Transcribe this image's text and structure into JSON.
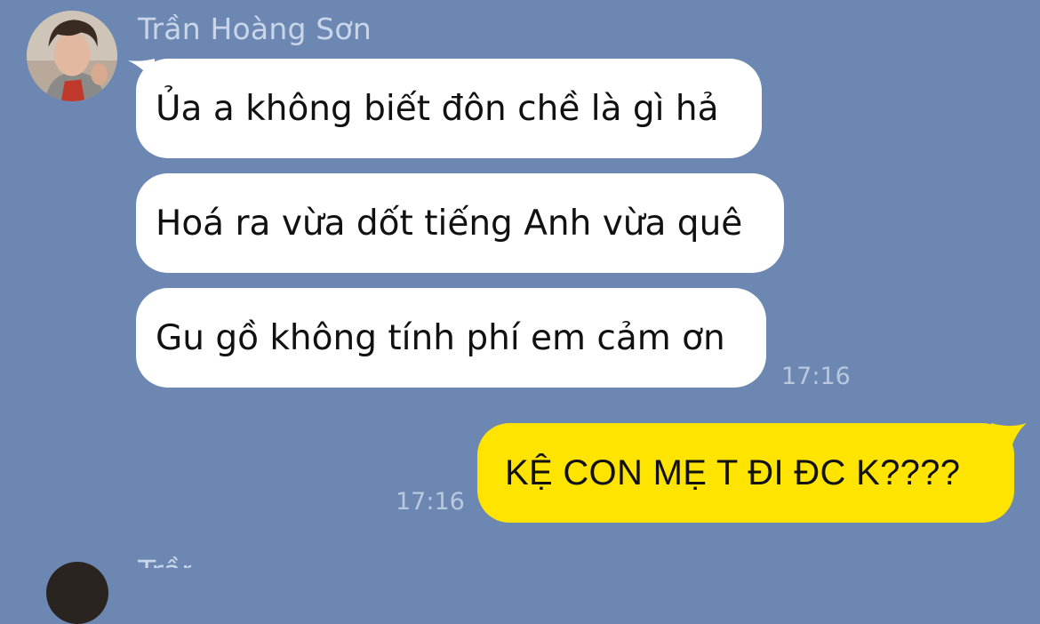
{
  "chat": {
    "incoming_group": {
      "sender_name": "Trần Hoàng Sơn",
      "messages": [
        "Ủa a không biết đôn chề là gì hả",
        "Hoá ra vừa dốt tiếng Anh vừa quê",
        "Gu gồ không tính phí em cảm ơn"
      ],
      "time": "17:16"
    },
    "outgoing": {
      "message": "KỆ CON MẸ T ĐI ĐC K????",
      "time": "17:16"
    },
    "next_group": {
      "sender_name": "Trần Hoàng Sơn"
    }
  },
  "colors": {
    "background": "#6b87b2",
    "incoming_bubble": "#ffffff",
    "outgoing_bubble": "#ffe400",
    "name_text": "#c9d6ea",
    "time_text": "#b9c8df"
  }
}
